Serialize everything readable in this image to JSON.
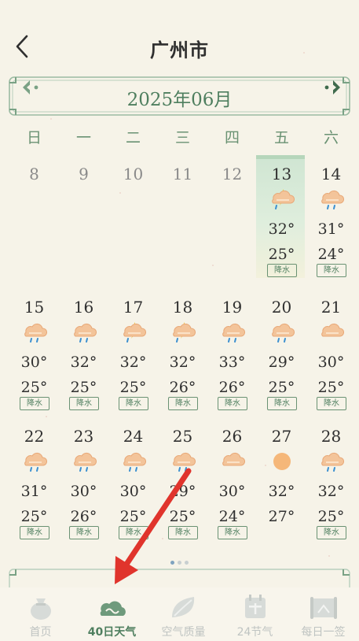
{
  "header": {
    "title": "广州市"
  },
  "calendar": {
    "month_label": "2025年06月",
    "weekdays": [
      "日",
      "一",
      "二",
      "三",
      "四",
      "五",
      "六"
    ],
    "rain_tag": "降水",
    "past_days": [
      "8",
      "9",
      "10",
      "11",
      "12"
    ],
    "days": [
      {
        "date": "13",
        "icon": "thunder-rain",
        "hi": "32°",
        "lo": "25°",
        "tag": true,
        "today": true
      },
      {
        "date": "14",
        "icon": "rain",
        "hi": "31°",
        "lo": "24°",
        "tag": true
      },
      {
        "date": "15",
        "icon": "rain",
        "hi": "30°",
        "lo": "25°",
        "tag": true
      },
      {
        "date": "16",
        "icon": "rain",
        "hi": "32°",
        "lo": "25°",
        "tag": true
      },
      {
        "date": "17",
        "icon": "thunder-rain",
        "hi": "32°",
        "lo": "25°",
        "tag": true
      },
      {
        "date": "18",
        "icon": "thunder-rain",
        "hi": "32°",
        "lo": "26°",
        "tag": true
      },
      {
        "date": "19",
        "icon": "rain",
        "hi": "33°",
        "lo": "26°",
        "tag": true
      },
      {
        "date": "20",
        "icon": "rain",
        "hi": "29°",
        "lo": "25°",
        "tag": true
      },
      {
        "date": "21",
        "icon": "cloudy",
        "hi": "30°",
        "lo": "25°",
        "tag": true
      },
      {
        "date": "22",
        "icon": "rain",
        "hi": "31°",
        "lo": "25°",
        "tag": true
      },
      {
        "date": "23",
        "icon": "rain",
        "hi": "30°",
        "lo": "26°",
        "tag": true
      },
      {
        "date": "24",
        "icon": "rain",
        "hi": "30°",
        "lo": "25°",
        "tag": true
      },
      {
        "date": "25",
        "icon": "rain",
        "hi": "29°",
        "lo": "25°",
        "tag": true
      },
      {
        "date": "26",
        "icon": "cloudy",
        "hi": "30°",
        "lo": "24°",
        "tag": true
      },
      {
        "date": "27",
        "icon": "sunny",
        "hi": "32°",
        "lo": "27°",
        "tag": false
      },
      {
        "date": "28",
        "icon": "rain",
        "hi": "32°",
        "lo": "25°",
        "tag": true
      }
    ]
  },
  "tabs": [
    {
      "label": "首页",
      "icon": "bag-icon"
    },
    {
      "label": "40日天气",
      "icon": "cloud-icon",
      "active": true
    },
    {
      "label": "空气质量",
      "icon": "leaf-icon"
    },
    {
      "label": "24节气",
      "icon": "calendar-icon"
    },
    {
      "label": "每日一签",
      "icon": "scroll-icon"
    }
  ],
  "colors": {
    "accent": "#4f7f5f",
    "today": "#cfe5d2",
    "background": "#f6f3e8",
    "arrow": "#e0342c"
  }
}
